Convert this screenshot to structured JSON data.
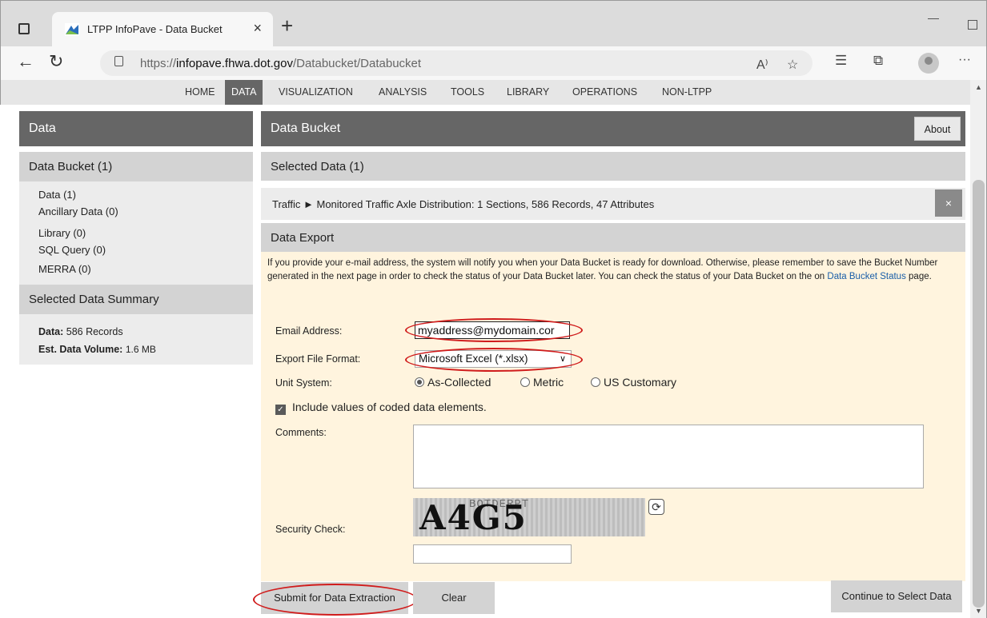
{
  "browser": {
    "tab_title": "LTPP InfoPave - Data Bucket",
    "tab_close": "×",
    "new_tab": "+",
    "url_prefix": "https://",
    "url_domain": "infopave.fhwa.dot.gov",
    "url_path": "/Databucket/Databucket",
    "read_aloud": "A⁾",
    "more": "···"
  },
  "sitenav": {
    "items": [
      "HOME",
      "DATA",
      "VISUALIZATION",
      "ANALYSIS",
      "TOOLS",
      "LIBRARY",
      "OPERATIONS",
      "NON-LTPP"
    ],
    "active": "DATA"
  },
  "sidebar": {
    "title": "Data",
    "bucket_heading": "Data Bucket (1)",
    "links": [
      "Data (1)",
      "Ancillary Data (0)",
      "Library (0)",
      "SQL Query (0)",
      "MERRA (0)"
    ],
    "summary_heading": "Selected Data Summary",
    "summary_data_label": "Data:",
    "summary_data_value": "586 Records",
    "summary_volume_label": "Est. Data Volume:",
    "summary_volume_value": "1.6 MB"
  },
  "main": {
    "title": "Data Bucket",
    "about": "About",
    "selected_heading": "Selected Data (1)",
    "traffic_item": "Traffic ► Monitored Traffic Axle Distribution: 1 Sections, 586 Records, 47 Attributes",
    "remove": "×",
    "export_heading": "Data Export",
    "notice_before": "If you provide your e-mail address, the system will notify you when your Data Bucket is ready for download. Otherwise, please remember to save the Bucket Number generated in the next page in order to check the status of your Data Bucket later. You can check the status of your Data Bucket on the on ",
    "notice_link": "Data Bucket Status",
    "notice_after": " page.",
    "email_label": "Email Address:",
    "email_value": "myaddress@mydomain.cor",
    "format_label": "Export File Format:",
    "format_value": "Microsoft Excel (*.xlsx)",
    "unit_label": "Unit System:",
    "unit_options": [
      "As-Collected",
      "Metric",
      "US Customary"
    ],
    "unit_selected": "As-Collected",
    "include_coded": "Include values of coded data elements.",
    "comments_label": "Comments:",
    "captcha_text": "A4G5",
    "captcha_noise": "BOTDERPT",
    "security_label": "Security Check:",
    "submit": "Submit for Data Extraction",
    "clear": "Clear",
    "continue": "Continue to Select Data"
  },
  "colors": {
    "header_gray": "#666666",
    "panel_cream": "#fff4de",
    "highlight_red": "#d01c1c",
    "link_blue": "#1a5ea8"
  }
}
